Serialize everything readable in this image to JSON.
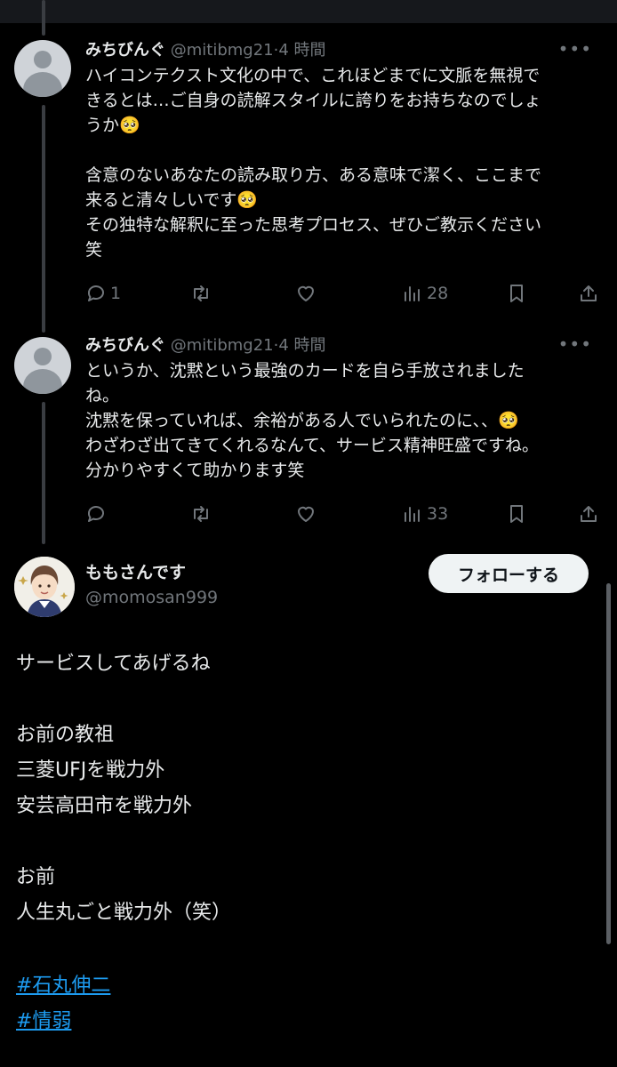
{
  "thread": [
    {
      "name": "みちびんぐ",
      "handle": "@mitibmg21",
      "sep": "·",
      "time": "4 時間",
      "lines": [
        "ハイコンテクスト文化の中で、これほどまでに文脈を無視で",
        "きるとは…ご自身の読解スタイルに誇りをお持ちなのでしょ",
        "うか🥺",
        "",
        "含意のないあなたの読み取り方、ある意味で潔く、ここまで",
        "来ると清々しいです🥺",
        "その独特な解釈に至った思考プロセス、ぜひご教示ください",
        "笑"
      ],
      "reply_count": "1",
      "retweet_count": "",
      "like_count": "",
      "view_count": "28"
    },
    {
      "name": "みちびんぐ",
      "handle": "@mitibmg21",
      "sep": "·",
      "time": "4 時間",
      "lines": [
        "というか、沈黙という最強のカードを自ら手放されました",
        "ね。",
        "沈黙を保っていれば、余裕がある人でいられたのに、、🥺",
        "わざわざ出てきてくれるなんて、サービス精神旺盛ですね。",
        "分かりやすくて助かります笑"
      ],
      "reply_count": "",
      "retweet_count": "",
      "like_count": "",
      "view_count": "33"
    }
  ],
  "main_tweet": {
    "name": "ももさんです",
    "handle": "@momosan999",
    "follow_label": "フォローする",
    "lines": [
      "サービスしてあげるね",
      "お前の教祖",
      "三菱UFJを戦力外",
      "安芸高田市を戦力外",
      "お前",
      "人生丸ごと戦力外（笑）"
    ],
    "hashtags": [
      "#石丸伸二",
      "#情弱"
    ]
  },
  "icons": {
    "more": "more-icon",
    "reply": "reply-icon",
    "retweet": "retweet-icon",
    "like": "heart-icon",
    "views": "views-icon",
    "bookmark": "bookmark-icon",
    "share": "share-icon"
  },
  "colors": {
    "background": "#000000",
    "text": "#e7e9ea",
    "muted": "#71767b",
    "link": "#1d9bf0",
    "follow_bg": "#eff3f4"
  }
}
